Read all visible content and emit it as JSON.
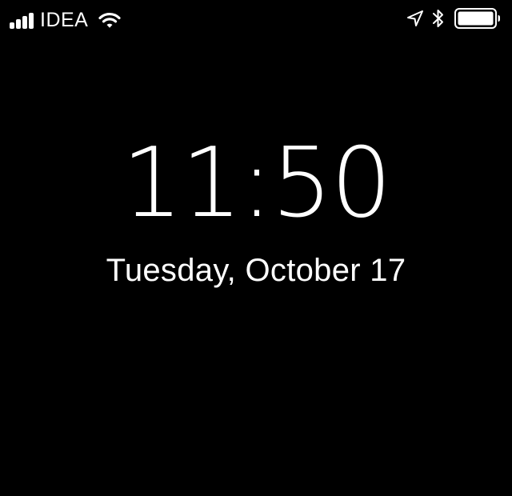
{
  "status_bar": {
    "carrier": "IDEA",
    "signal_bars": 4,
    "icons": {
      "signal": "cellular-signal-icon",
      "wifi": "wifi-icon",
      "location": "location-arrow-icon",
      "bluetooth": "bluetooth-icon",
      "battery": "battery-icon"
    },
    "battery_level": 1.0
  },
  "lock_screen": {
    "time": "11:50",
    "date": "Tuesday, October 17"
  },
  "colors": {
    "background": "#000000",
    "foreground": "#ffffff"
  }
}
